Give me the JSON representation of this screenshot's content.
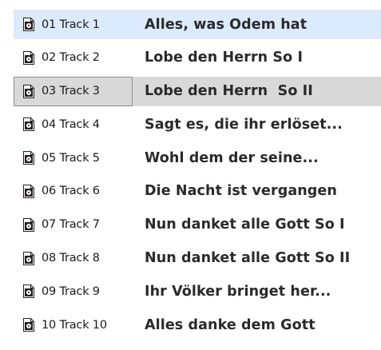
{
  "tracks": [
    {
      "file": "01 Track 1",
      "title": "Alles, was Odem hat",
      "icon": "audio-file-icon"
    },
    {
      "file": "02 Track 2",
      "title": "Lobe den Herrn So I",
      "icon": "audio-file-icon"
    },
    {
      "file": "03 Track 3",
      "title": "Lobe den Herrn  So II",
      "icon": "audio-file-icon"
    },
    {
      "file": "04 Track 4",
      "title": "Sagt es, die ihr erlöset...",
      "icon": "audio-file-icon"
    },
    {
      "file": "05 Track 5",
      "title": "Wohl dem der seine...",
      "icon": "audio-file-icon"
    },
    {
      "file": "06 Track 6",
      "title": "Die Nacht ist vergangen",
      "icon": "audio-file-icon"
    },
    {
      "file": "07 Track 7",
      "title": "Nun danket alle Gott So I",
      "icon": "audio-file-icon"
    },
    {
      "file": "08 Track 8",
      "title": "Nun danket alle Gott So II",
      "icon": "audio-file-icon"
    },
    {
      "file": "09 Track 9",
      "title": "Ihr Völker bringet her...",
      "icon": "audio-file-icon"
    },
    {
      "file": "10 Track 10",
      "title": "Alles danke dem Gott",
      "icon": "audio-file-icon"
    }
  ],
  "colors": {
    "hover_row": "#dcebfc",
    "selected_row": "#d9d9d9",
    "selected_border": "#8a8a8a",
    "icon_accent": "#1a1a1a"
  }
}
